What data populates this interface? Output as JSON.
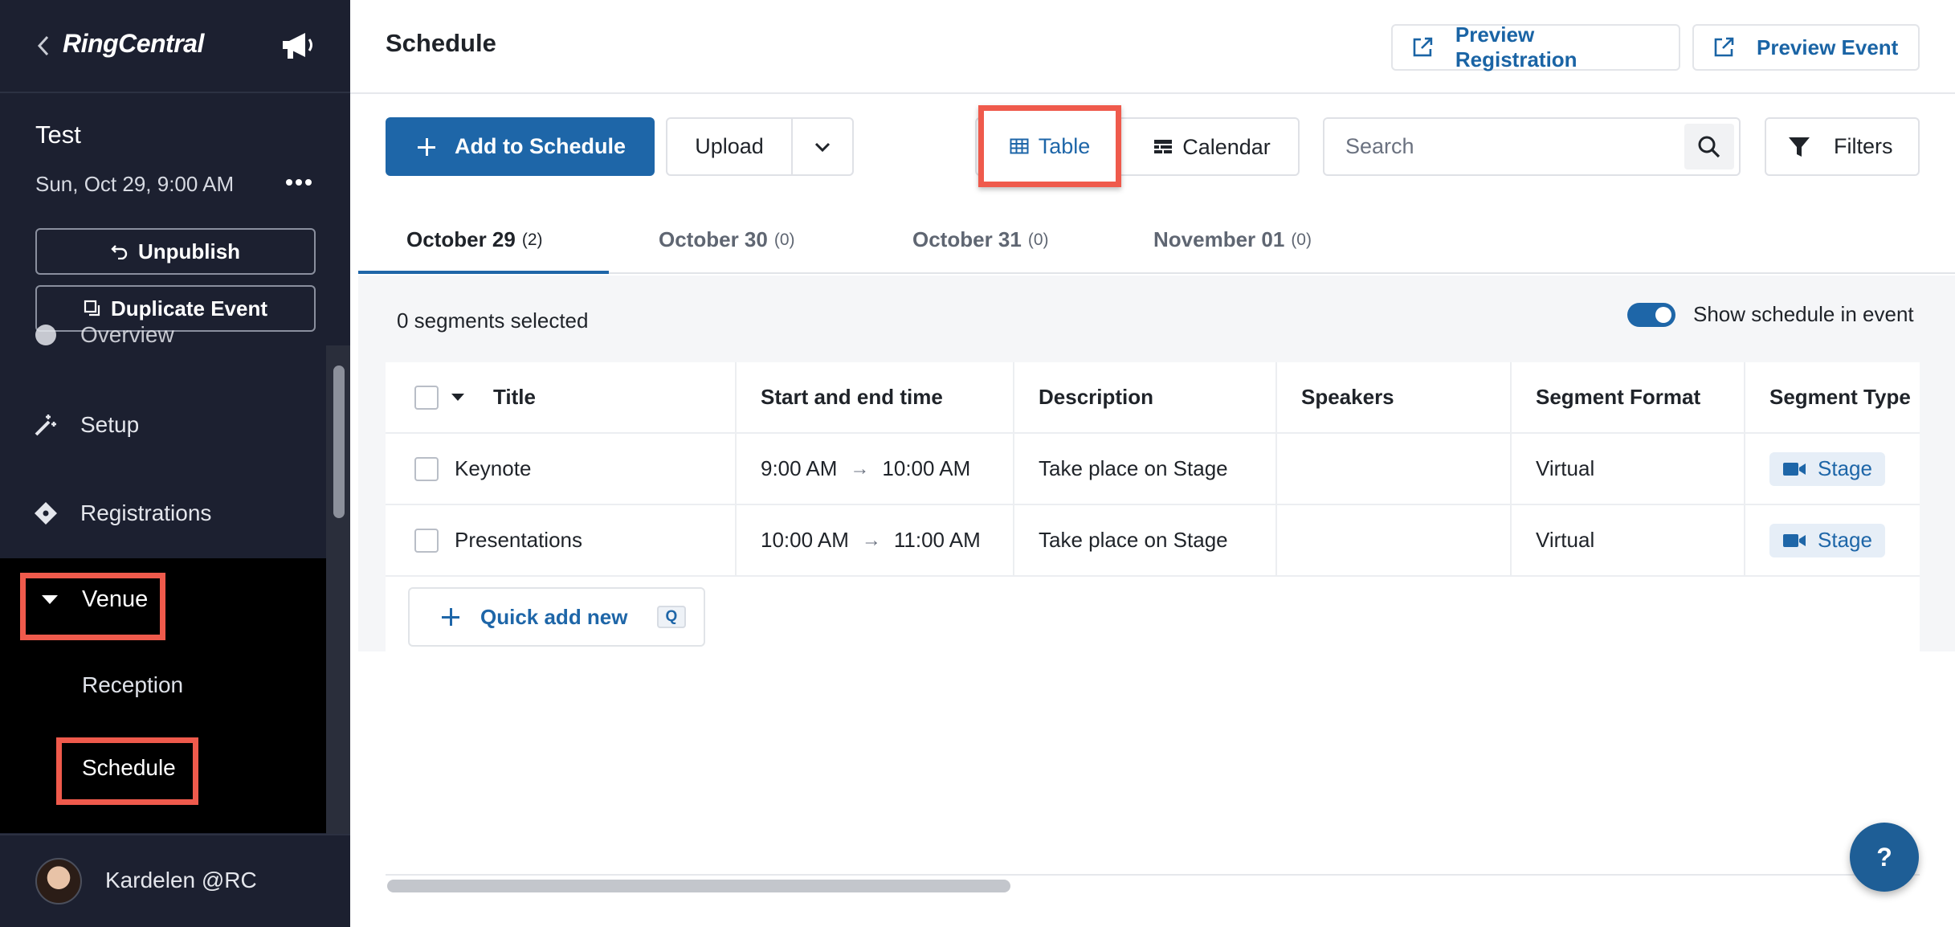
{
  "sidebar": {
    "logo": "RingCentral",
    "event": {
      "title": "Test",
      "date": "Sun, Oct 29, 9:00 AM"
    },
    "buttons": {
      "unpublish": "Unpublish",
      "duplicate": "Duplicate Event"
    },
    "nav": {
      "overview": "Overview",
      "setup": "Setup",
      "registrations": "Registrations",
      "venue": "Venue",
      "venue_children": [
        "Reception",
        "Schedule"
      ]
    },
    "user": {
      "name": "Kardelen @RC"
    }
  },
  "header": {
    "title": "Schedule",
    "preview_registration": "Preview Registration",
    "preview_event": "Preview Event"
  },
  "toolbar": {
    "add_label": "Add to Schedule",
    "upload_label": "Upload",
    "view_table": "Table",
    "view_calendar": "Calendar",
    "search_placeholder": "Search",
    "filters_label": "Filters"
  },
  "date_tabs": [
    {
      "label": "October 29",
      "count": "(2)"
    },
    {
      "label": "October 30",
      "count": "(0)"
    },
    {
      "label": "October 31",
      "count": "(0)"
    },
    {
      "label": "November 01",
      "count": "(0)"
    }
  ],
  "content": {
    "selected_text": "0 segments selected",
    "show_schedule_label": "Show schedule in event",
    "columns": [
      "Title",
      "Start and end time",
      "Description",
      "Speakers",
      "Segment Format",
      "Segment Type"
    ],
    "rows": [
      {
        "title": "Keynote",
        "start": "9:00 AM",
        "end": "10:00 AM",
        "description": "Take place on Stage",
        "speakers": "",
        "format": "Virtual",
        "type": "Stage"
      },
      {
        "title": "Presentations",
        "start": "10:00 AM",
        "end": "11:00 AM",
        "description": "Take place on Stage",
        "speakers": "",
        "format": "Virtual",
        "type": "Stage"
      }
    ],
    "arrow": "→",
    "quick_add_label": "Quick add new",
    "quick_add_shortcut": "Q"
  },
  "help_label": "?",
  "colors": {
    "primary": "#1e66a8",
    "sidebar_bg": "#1c2030",
    "highlight": "#ef5a4c"
  }
}
